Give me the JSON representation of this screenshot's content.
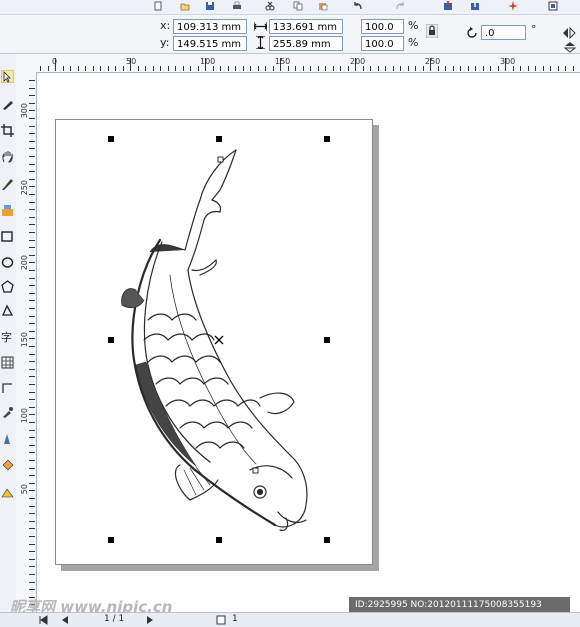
{
  "propbar": {
    "x_label": "x:",
    "y_label": "y:",
    "x_value": "109.313 mm",
    "y_value": "149.515 mm",
    "width_value": "133.691 mm",
    "height_value": "255.89 mm",
    "scale_w": "100.0",
    "scale_h": "100.0",
    "pct_symbol_1": "%",
    "pct_symbol_2": "%",
    "rotation_value": ".0",
    "degree_symbol": "°"
  },
  "ruler_h": [
    "0",
    "50",
    "100",
    "150",
    "200",
    "250",
    "300"
  ],
  "ruler_v": [
    "300",
    "250",
    "200",
    "150",
    "100",
    "50"
  ],
  "status": {
    "page_indicator": "1 / 1",
    "page_tab": "1"
  },
  "watermark": {
    "site": "昵享网 www.nipic.cn"
  },
  "image_id": "ID:2925995 NO:20120111175008355193",
  "colors": {
    "page_bg": "#ffffff",
    "shadow": "#a6a6a6",
    "handle": "#000000",
    "fish_stroke": "#2a2a2a"
  }
}
